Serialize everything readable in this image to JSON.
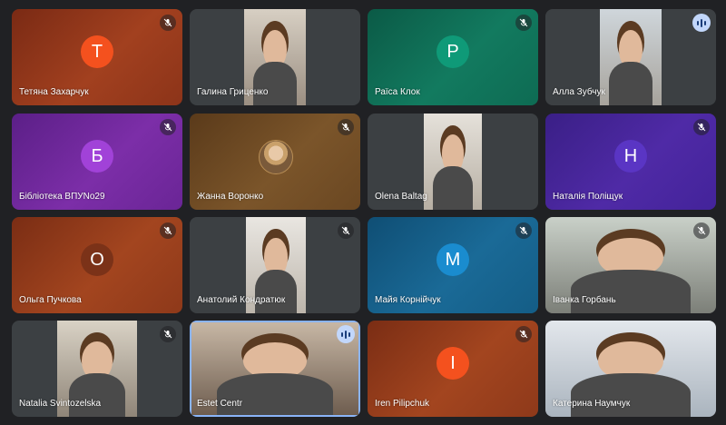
{
  "meeting": {
    "participants": [
      {
        "name": "Тетяна Захарчук",
        "initial": "Т",
        "tile": "avatar",
        "mic": "muted"
      },
      {
        "name": "Галина Гриценко",
        "initial": "",
        "tile": "camera",
        "mic": "none"
      },
      {
        "name": "Раїса Клок",
        "initial": "Р",
        "tile": "avatar",
        "mic": "muted"
      },
      {
        "name": "Алла Зубчук",
        "initial": "",
        "tile": "camera",
        "mic": "speaking"
      },
      {
        "name": "Бібліотека ВПУNo29",
        "initial": "Б",
        "tile": "avatar",
        "mic": "muted"
      },
      {
        "name": "Жанна Воронко",
        "initial": "",
        "tile": "profile-photo",
        "mic": "muted"
      },
      {
        "name": "Olena Baltag",
        "initial": "",
        "tile": "camera",
        "mic": "none"
      },
      {
        "name": "Наталія Поліщук",
        "initial": "Н",
        "tile": "avatar",
        "mic": "muted"
      },
      {
        "name": "Ольга Пучкова",
        "initial": "О",
        "tile": "avatar",
        "mic": "muted"
      },
      {
        "name": "Анатолий Кондратюк",
        "initial": "",
        "tile": "camera",
        "mic": "muted"
      },
      {
        "name": "Майя Корнійчук",
        "initial": "М",
        "tile": "avatar",
        "mic": "muted"
      },
      {
        "name": "Іванка Горбань",
        "initial": "",
        "tile": "camera",
        "mic": "muted"
      },
      {
        "name": "Natalia Svintozelska",
        "initial": "",
        "tile": "camera",
        "mic": "muted"
      },
      {
        "name": "Estet Centr",
        "initial": "",
        "tile": "camera",
        "mic": "speaking"
      },
      {
        "name": "Iren Pilipchuk",
        "initial": "І",
        "tile": "avatar",
        "mic": "muted"
      },
      {
        "name": "Катерина Наумчук",
        "initial": "",
        "tile": "camera",
        "mic": "none"
      }
    ]
  },
  "icons": {
    "muted": "mic-off-icon",
    "speaking": "audio-level-icon"
  },
  "colors": {
    "background": "#202124",
    "speaking_badge": "#c2d7fb",
    "active_outline": "#8ab4f8"
  }
}
